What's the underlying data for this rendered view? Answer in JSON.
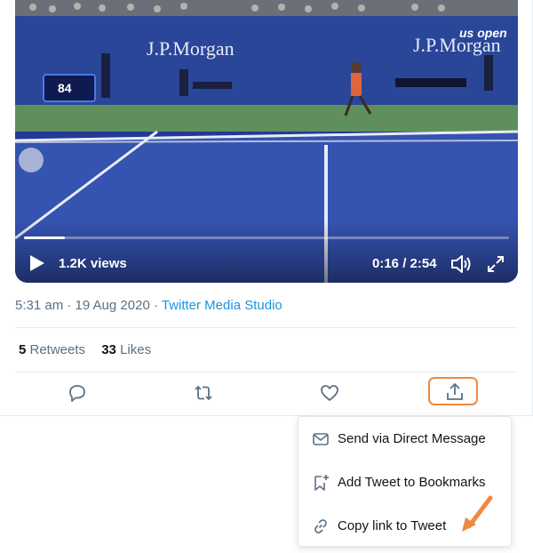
{
  "video": {
    "views": "1.2K views",
    "time": "0:16 / 2:54",
    "progress": 0.084,
    "scene": {
      "court_banner_left": "J.P.Morgan",
      "court_banner_right": "J.P.Morgan",
      "tournament_logo": "us open",
      "scoreboard_speed": "84"
    }
  },
  "meta": {
    "timestamp": "5:31 am · 19 Aug 2020 · ",
    "source": "Twitter Media Studio"
  },
  "stats": {
    "retweets_count": "5",
    "retweets_label": " Retweets",
    "likes_count": "33",
    "likes_label": " Likes"
  },
  "actions": {
    "icons": [
      "reply-icon",
      "retweet-icon",
      "like-icon",
      "share-icon"
    ]
  },
  "share_menu": {
    "items": [
      {
        "label": "Send via Direct Message",
        "icon": "envelope-icon"
      },
      {
        "label": "Add Tweet to Bookmarks",
        "icon": "bookmark-add-icon"
      },
      {
        "label": "Copy link to Tweet",
        "icon": "link-icon"
      }
    ]
  },
  "colors": {
    "accent_link": "#1b95e0",
    "highlight": "#f0883e",
    "muted_text": "#5b7083",
    "court_blue": "#223a97",
    "court_green": "#5f8f5d"
  }
}
